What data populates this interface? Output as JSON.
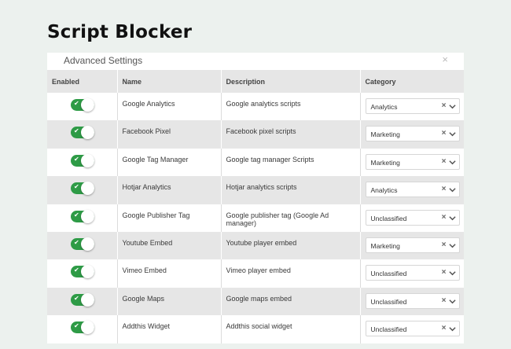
{
  "page": {
    "title": "Script Blocker"
  },
  "panel": {
    "title": "Advanced Settings",
    "close_icon": "×"
  },
  "table": {
    "headers": {
      "enabled": "Enabled",
      "name": "Name",
      "description": "Description",
      "category": "Category"
    },
    "rows": [
      {
        "enabled": true,
        "name": "Google Analytics",
        "description": "Google analytics scripts",
        "category": "Analytics"
      },
      {
        "enabled": true,
        "name": "Facebook Pixel",
        "description": "Facebook pixel scripts",
        "category": "Marketing"
      },
      {
        "enabled": true,
        "name": "Google Tag Manager",
        "description": "Google tag manager Scripts",
        "category": "Marketing"
      },
      {
        "enabled": true,
        "name": "Hotjar Analytics",
        "description": "Hotjar analytics scripts",
        "category": "Analytics"
      },
      {
        "enabled": true,
        "name": "Google Publisher Tag",
        "description": "Google publisher tag (Google Ad manager)",
        "category": "Unclassified"
      },
      {
        "enabled": true,
        "name": "Youtube Embed",
        "description": "Youtube player embed",
        "category": "Marketing"
      },
      {
        "enabled": true,
        "name": "Vimeo Embed",
        "description": "Vimeo player embed",
        "category": "Unclassified"
      },
      {
        "enabled": true,
        "name": "Google Maps",
        "description": "Google maps embed",
        "category": "Unclassified"
      },
      {
        "enabled": true,
        "name": "Addthis Widget",
        "description": "Addthis social widget",
        "category": "Unclassified"
      }
    ]
  },
  "icons": {
    "toggle_check": "check-icon",
    "clear": "clear-icon",
    "dropdown": "chevron-down-icon"
  },
  "colors": {
    "toggle_on": "#2e9b46",
    "background": "#ecf1ee",
    "row_alt": "#e6e6e6"
  }
}
